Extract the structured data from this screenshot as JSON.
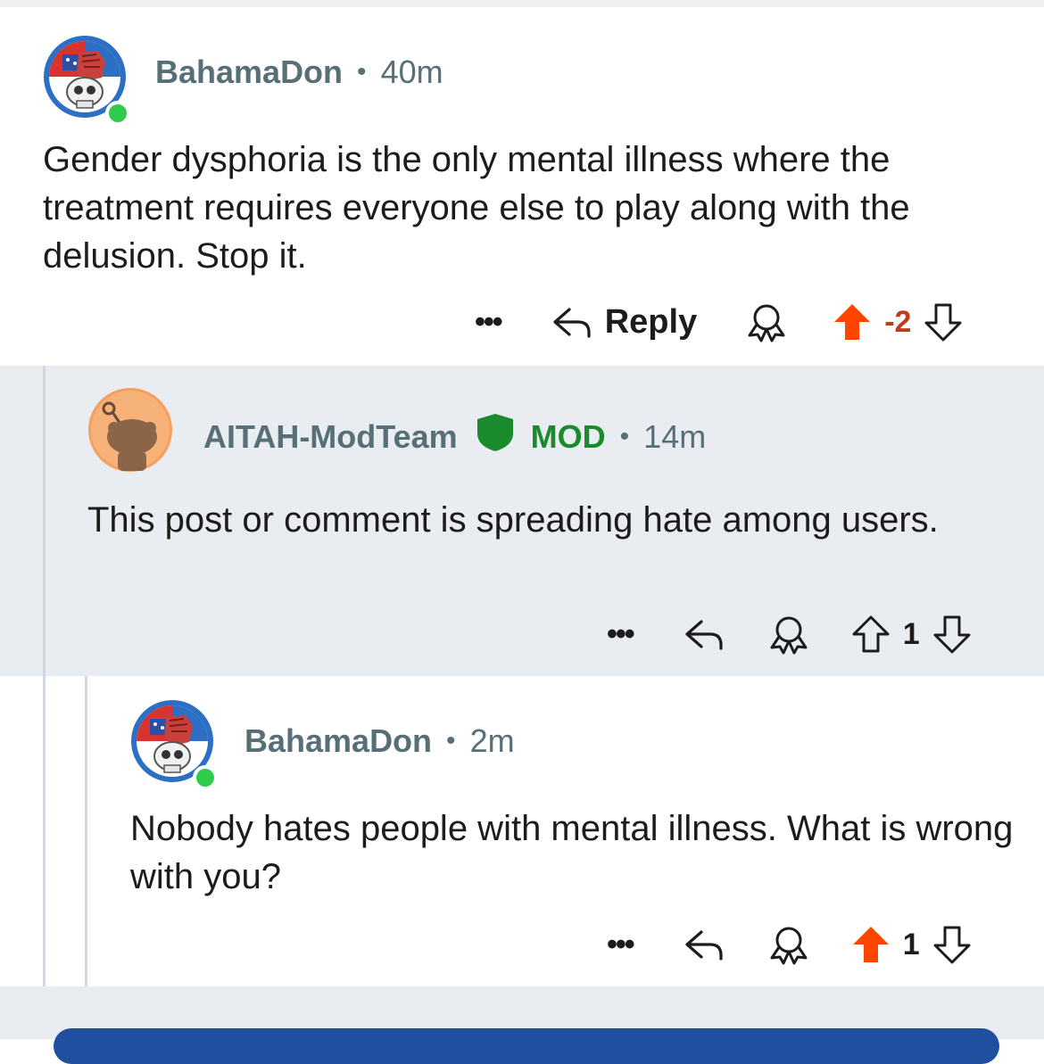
{
  "comments": [
    {
      "username": "BahamaDon",
      "time": "40m",
      "text": "Gender dysphoria is the only mental illness where the treatment requires everyone else to play along with the delusion. Stop it.",
      "reply_label": "Reply",
      "votes": "-2",
      "upvoted": true
    },
    {
      "username": "AITAH-ModTeam",
      "badge": "MOD",
      "time": "14m",
      "text": "This post or comment is spreading hate among users.",
      "votes": "1",
      "upvoted": false
    },
    {
      "username": "BahamaDon",
      "time": "2m",
      "text": "Nobody hates people with mental illness. What is wrong with you?",
      "votes": "1",
      "upvoted": true
    }
  ],
  "colors": {
    "upvote": "#ff4500",
    "mod_green": "#1a8a2c",
    "negative_score": "#c23b1c",
    "thread_bg": "#e9ecf0"
  },
  "icons": [
    "more-icon",
    "reply-icon",
    "award-icon",
    "upvote-icon",
    "downvote-icon",
    "mod-shield-icon"
  ]
}
